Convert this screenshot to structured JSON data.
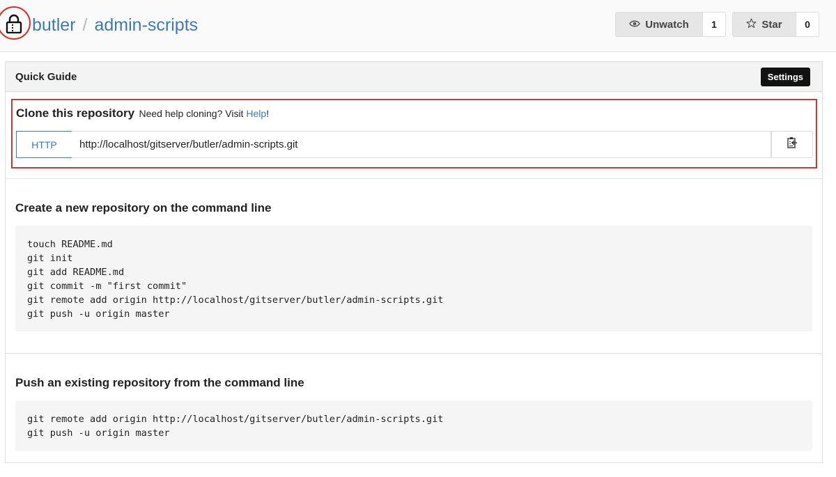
{
  "header": {
    "owner": "butler",
    "separator": "/",
    "repo": "admin-scripts",
    "lock_icon": "lock-icon",
    "watch": {
      "label": "Unwatch",
      "count": "1",
      "icon": "eye-icon"
    },
    "star": {
      "label": "Star",
      "count": "0",
      "icon": "star-icon"
    }
  },
  "panel": {
    "title": "Quick Guide",
    "settings_label": "Settings"
  },
  "clone": {
    "heading": "Clone this repository",
    "help_prefix": "Need help cloning? Visit",
    "help_link": "Help",
    "help_suffix": "!",
    "protocol": "HTTP",
    "url": "http://localhost/gitserver/butler/admin-scripts.git",
    "copy_icon": "clipboard-icon"
  },
  "new_repo": {
    "title": "Create a new repository on the command line",
    "lines": [
      "touch README.md",
      "git init",
      "git add README.md",
      "git commit -m \"first commit\"",
      "git remote add origin http://localhost/gitserver/butler/admin-scripts.git",
      "git push -u origin master"
    ]
  },
  "existing_repo": {
    "title": "Push an existing repository from the command line",
    "lines": [
      "git remote add origin http://localhost/gitserver/butler/admin-scripts.git",
      "git push -u origin master"
    ]
  },
  "colors": {
    "link": "#3c7ab8",
    "highlight": "#d9312b",
    "code_bg": "#f5f5f5"
  }
}
